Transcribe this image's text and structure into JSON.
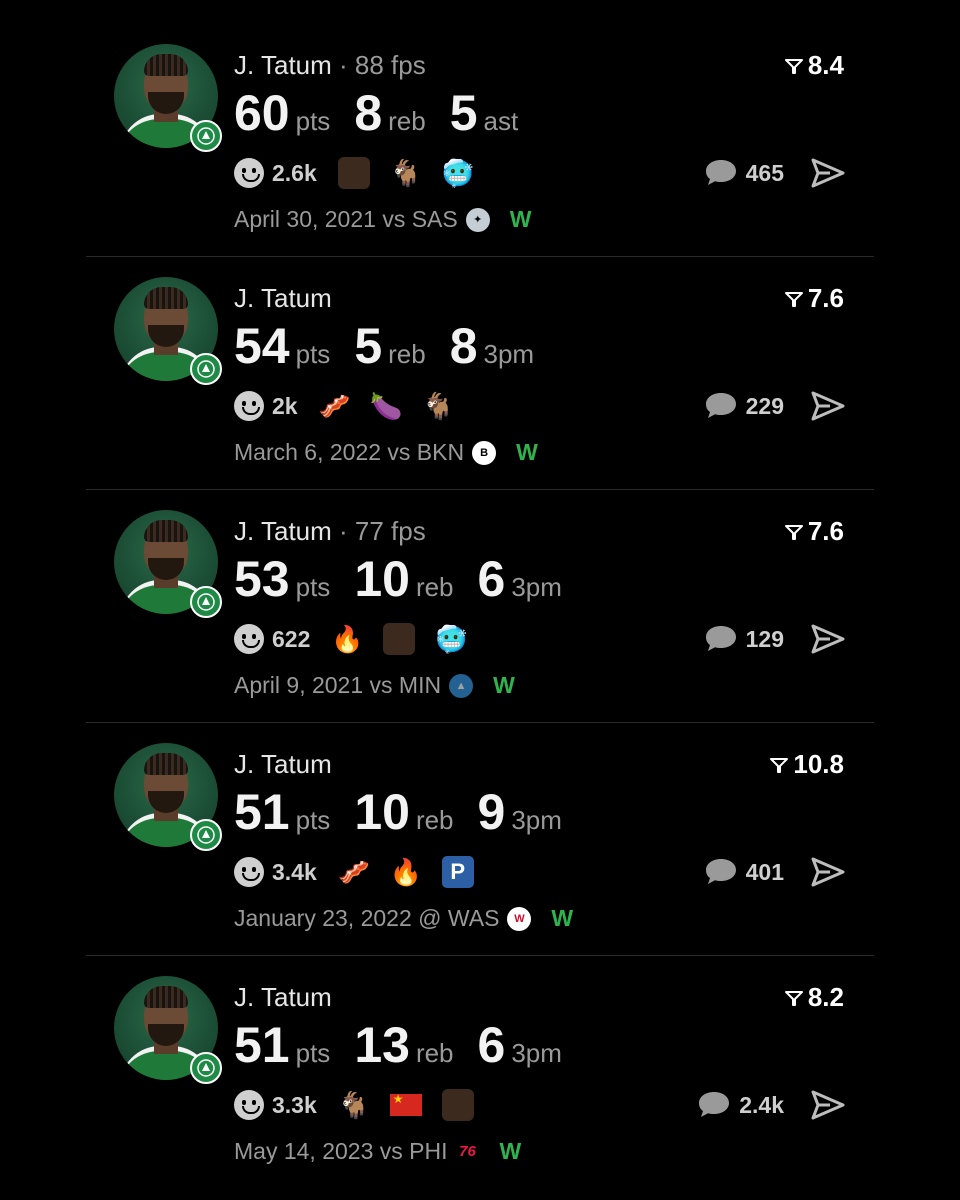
{
  "posts": [
    {
      "name": "J. Tatum",
      "fps": "· 88 fps",
      "rating": "8.4",
      "stats": [
        {
          "num": "60",
          "unit": "pts"
        },
        {
          "num": "8",
          "unit": "reb"
        },
        {
          "num": "5",
          "unit": "ast"
        }
      ],
      "reactions": "2.6k",
      "emojis": [
        "face",
        "🐐",
        "🥶"
      ],
      "comments": "465",
      "date": "April 30, 2021 vs SAS",
      "team_icon": "spurs-logo",
      "result": "W"
    },
    {
      "name": "J. Tatum",
      "fps": "",
      "rating": "7.6",
      "stats": [
        {
          "num": "54",
          "unit": "pts"
        },
        {
          "num": "5",
          "unit": "reb"
        },
        {
          "num": "8",
          "unit": "3pm"
        }
      ],
      "reactions": "2k",
      "emojis": [
        "🥓",
        "🍆",
        "🐐"
      ],
      "comments": "229",
      "date": "March 6, 2022 vs BKN",
      "team_icon": "nets-logo",
      "result": "W"
    },
    {
      "name": "J. Tatum",
      "fps": "· 77 fps",
      "rating": "7.6",
      "stats": [
        {
          "num": "53",
          "unit": "pts"
        },
        {
          "num": "10",
          "unit": "reb"
        },
        {
          "num": "6",
          "unit": "3pm"
        }
      ],
      "reactions": "622",
      "emojis": [
        "🔥",
        "face",
        "🥶"
      ],
      "comments": "129",
      "date": "April 9, 2021 vs MIN",
      "team_icon": "timberwolves-logo",
      "result": "W"
    },
    {
      "name": "J. Tatum",
      "fps": "",
      "rating": "10.8",
      "stats": [
        {
          "num": "51",
          "unit": "pts"
        },
        {
          "num": "10",
          "unit": "reb"
        },
        {
          "num": "9",
          "unit": "3pm"
        }
      ],
      "reactions": "3.4k",
      "emojis": [
        "🥓",
        "🔥",
        "P"
      ],
      "comments": "401",
      "date": "January 23, 2022 @ WAS",
      "team_icon": "wizards-logo",
      "result": "W"
    },
    {
      "name": "J. Tatum",
      "fps": "",
      "rating": "8.2",
      "stats": [
        {
          "num": "51",
          "unit": "pts"
        },
        {
          "num": "13",
          "unit": "reb"
        },
        {
          "num": "6",
          "unit": "3pm"
        }
      ],
      "reactions": "3.3k",
      "emojis": [
        "🐐",
        "flag",
        "face"
      ],
      "comments": "2.4k",
      "date": "May 14, 2023 vs PHI",
      "team_icon": "76ers-logo",
      "result": "W"
    }
  ],
  "colors": {
    "background": "#000000",
    "win": "#2fb34f",
    "muted": "#9a9a9a",
    "celtics_green": "#1f8a45"
  }
}
